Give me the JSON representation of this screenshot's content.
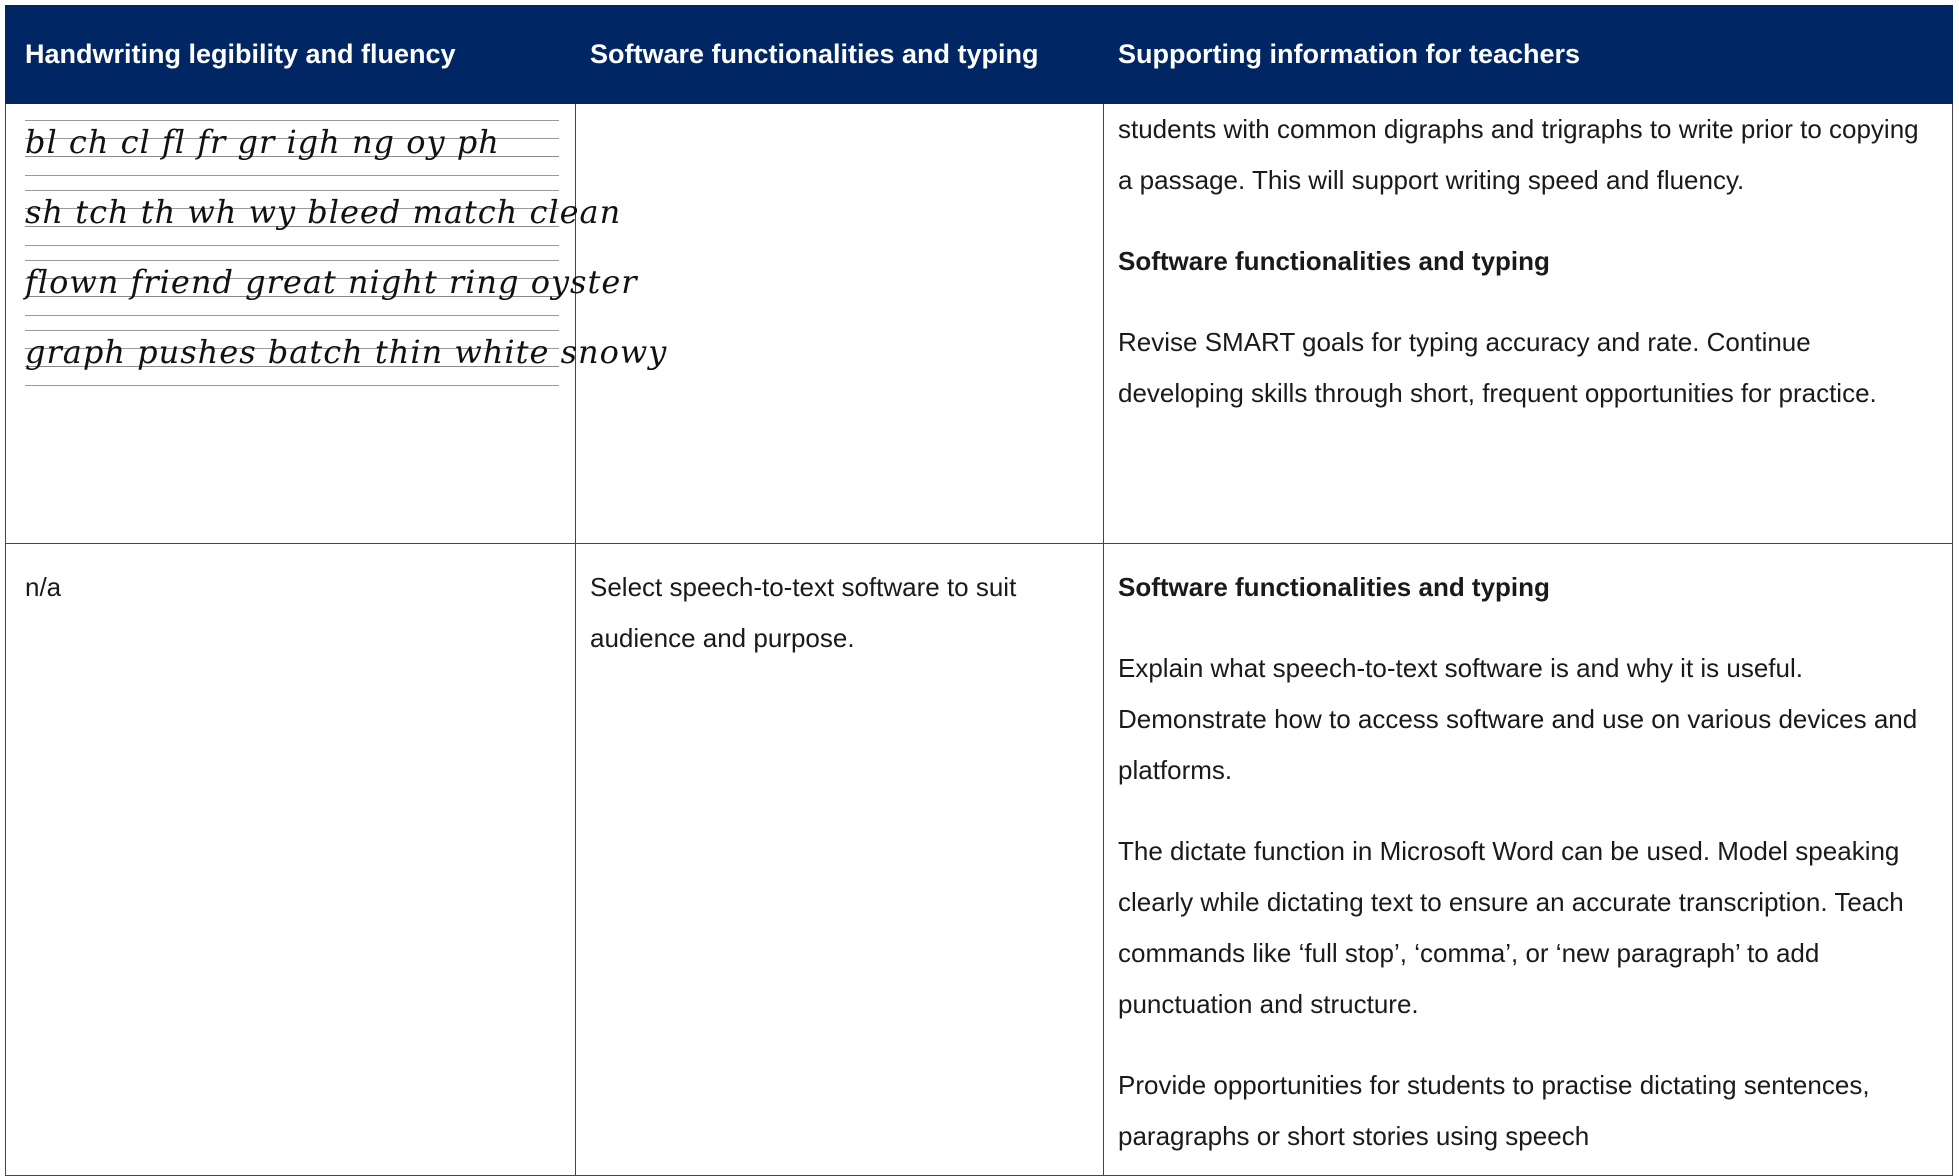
{
  "table": {
    "headers": [
      "Handwriting legibility and fluency",
      "Software functionalities and typing",
      "Supporting information for teachers"
    ],
    "row1": {
      "handwriting_lines": [
        "bl  ch  cl  fl  fr  gr  igh  ng  oy  ph",
        "sh  tch  th  wh  wy  bleed match clean",
        "flown friend great night ring oyster",
        "graph pushes batch thin white snowy"
      ],
      "software": "",
      "info_paragraph": "students with common digraphs and trigraphs to write prior to copying a passage. This will support writing speed and fluency.",
      "info_subheading": "Software functionalities and typing",
      "info_paragraph2": "Revise SMART goals for typing accuracy and rate. Continue developing skills through short, frequent opportunities for practice."
    },
    "row2": {
      "handwriting": "n/a",
      "software": "Select speech-to-text software to suit audience and purpose.",
      "info_subheading": "Software functionalities and typing",
      "info_paragraphs": [
        "Explain what speech-to-text software is and why it is useful. Demonstrate how to access software and use on various devices and platforms.",
        "The dictate function in Microsoft Word can be used. Model speaking clearly while dictating text to ensure an accurate transcription. Teach commands like ‘full stop’, ‘comma’, or ‘new paragraph’ to add punctuation and structure.",
        "Provide opportunities for students to practise dictating sentences, paragraphs or short stories using speech"
      ]
    }
  },
  "colors": {
    "header_background": "#002664",
    "header_text": "#ffffff",
    "border": "#444444"
  }
}
